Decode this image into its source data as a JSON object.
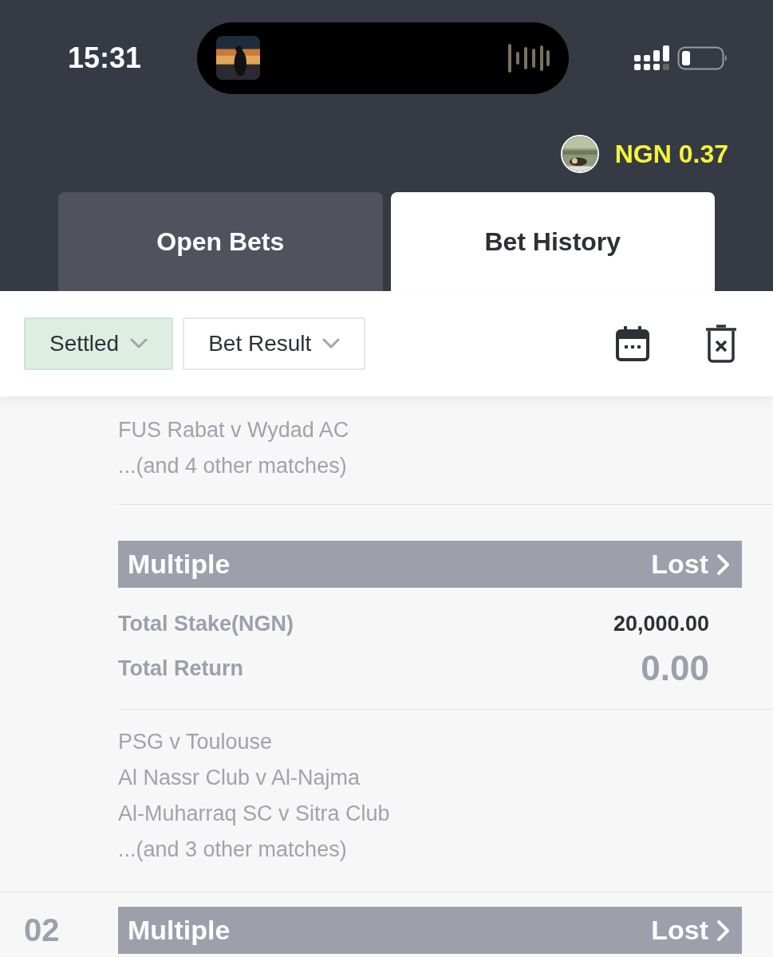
{
  "status_bar": {
    "time": "15:31"
  },
  "balance": {
    "amount": "NGN 0.37"
  },
  "tabs": [
    {
      "label": "Open Bets",
      "selected": false
    },
    {
      "label": "Bet History",
      "selected": true
    }
  ],
  "filters": [
    {
      "label": "Settled",
      "selected": true
    },
    {
      "label": "Bet Result",
      "selected": false
    }
  ],
  "bets": [
    {
      "matches": [
        "FUS Rabat v Wydad AC"
      ],
      "more": "...(and 4 other matches)"
    },
    {
      "type": "Multiple",
      "result": "Lost",
      "stake_label": "Total Stake(NGN)",
      "stake": "20,000.00",
      "return_label": "Total Return",
      "return": "0.00",
      "matches": [
        "PSG v Toulouse",
        "Al Nassr Club v Al-Najma",
        "Al-Muharraq SC v Sitra Club"
      ],
      "more": "...(and 3 other matches)"
    },
    {
      "number": "02",
      "type": "Multiple",
      "result": "Lost"
    }
  ]
}
